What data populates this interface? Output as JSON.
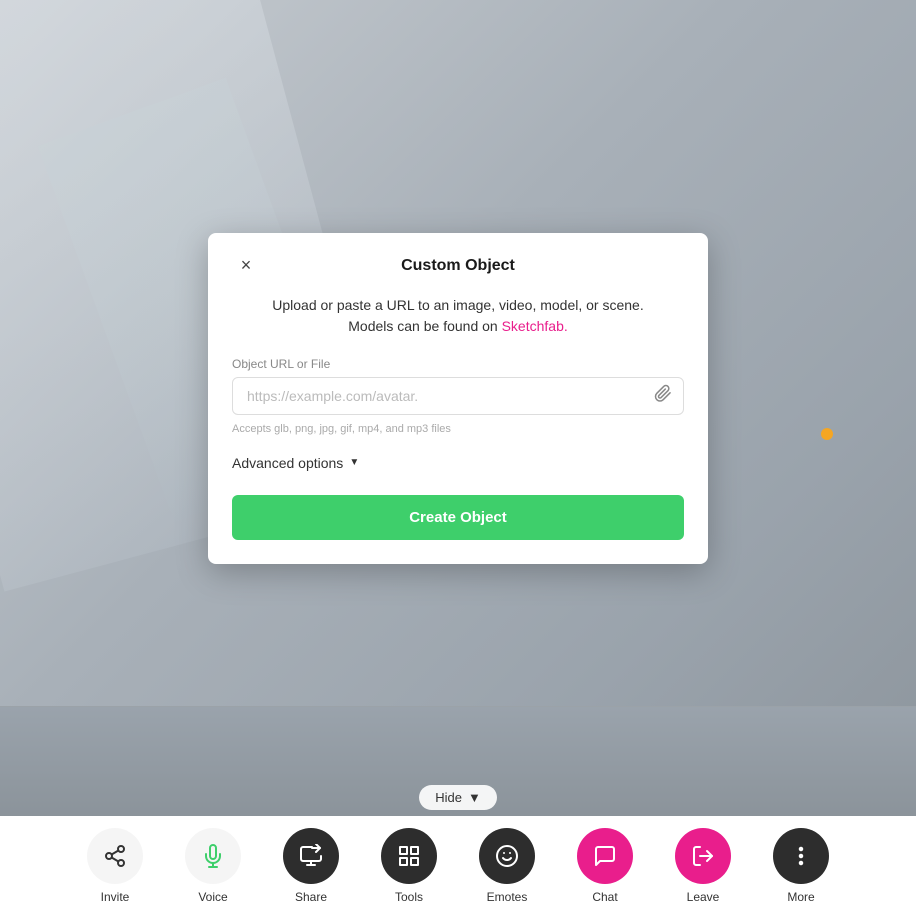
{
  "scene": {
    "bg_color": "#b0b8c1"
  },
  "modal": {
    "title": "Custom Object",
    "close_label": "×",
    "description_line1": "Upload or paste a URL to an image, video, model, or scene.",
    "description_line2": "Models can be found on",
    "sketchfab_link_text": "Sketchfab.",
    "sketchfab_url": "#",
    "field_label": "Object URL or File",
    "input_placeholder": "https://example.com/avatar.",
    "accepts_text": "Accepts glb, png, jpg, gif, mp4, and mp3 files",
    "advanced_options_label": "Advanced options",
    "create_button_label": "Create Object"
  },
  "toolbar": {
    "hide_label": "Hide",
    "items": [
      {
        "id": "invite",
        "label": "Invite",
        "icon": "share"
      },
      {
        "id": "voice",
        "label": "Voice",
        "icon": "mic"
      },
      {
        "id": "share",
        "label": "Share",
        "icon": "screen-share"
      },
      {
        "id": "tools",
        "label": "Tools",
        "icon": "grid"
      },
      {
        "id": "emotes",
        "label": "Emotes",
        "icon": "smiley"
      },
      {
        "id": "chat",
        "label": "Chat",
        "icon": "chat"
      },
      {
        "id": "leave",
        "label": "Leave",
        "icon": "exit"
      },
      {
        "id": "more",
        "label": "More",
        "icon": "dots"
      }
    ]
  }
}
